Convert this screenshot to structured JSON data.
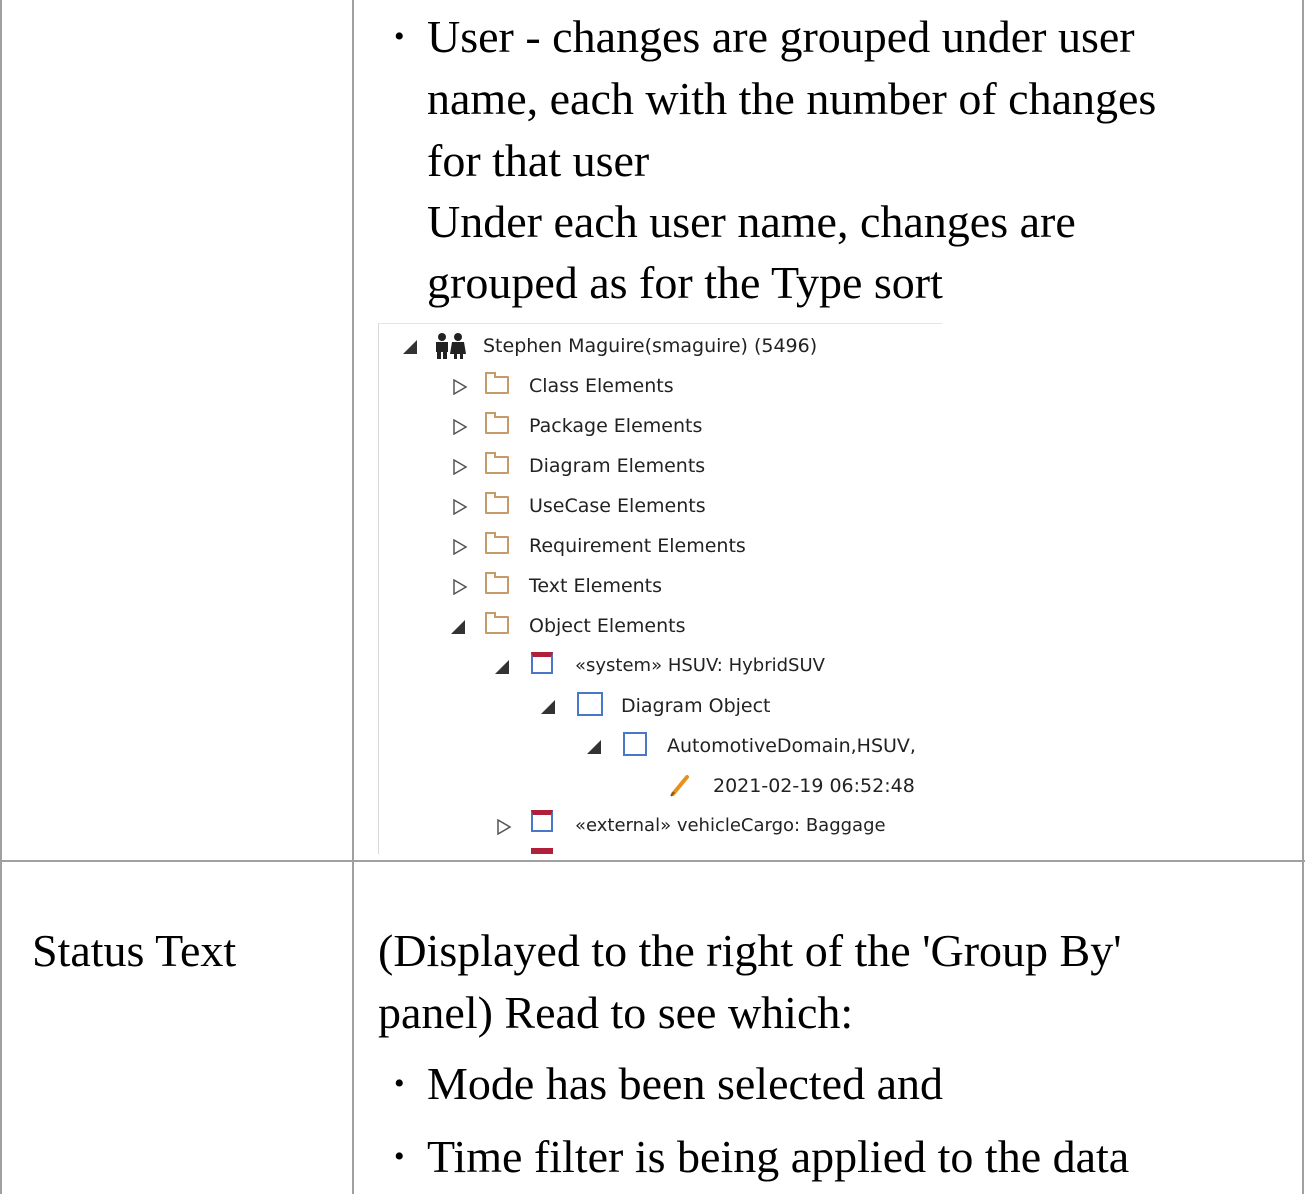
{
  "row1": {
    "bullet": "•",
    "lines": [
      "User - changes are grouped under user",
      "name, each with the number of changes",
      "for that user",
      "Under each user name, changes are",
      "grouped as for the Type sort"
    ]
  },
  "tree": {
    "root": "Stephen Maguire(smaguire) (5496)",
    "folders": [
      "Class Elements",
      "Package Elements",
      "Diagram Elements",
      "UseCase Elements",
      "Requirement Elements",
      "Text Elements",
      "Object Elements"
    ],
    "system_item": "«system» HSUV: HybridSUV",
    "diagram_object": "Diagram Object",
    "domain_item": "AutomotiveDomain,HSUV,",
    "timestamp": "2021-02-19 06:52:48",
    "external_item": "«external» vehicleCargo: Baggage"
  },
  "row2": {
    "label": "Status Text",
    "intro_lines": [
      "(Displayed to the right of the 'Group By'",
      "panel) Read to see which:"
    ],
    "bullets": [
      "Mode has been selected and",
      "Time filter is being applied to the data"
    ],
    "bullet": "•"
  },
  "colors": {
    "border": "#a0a0a0",
    "folder": "#c89a6a",
    "object": "#4a78c8",
    "stereotype_bar": "#b0203a",
    "pencil": "#e8901a"
  }
}
